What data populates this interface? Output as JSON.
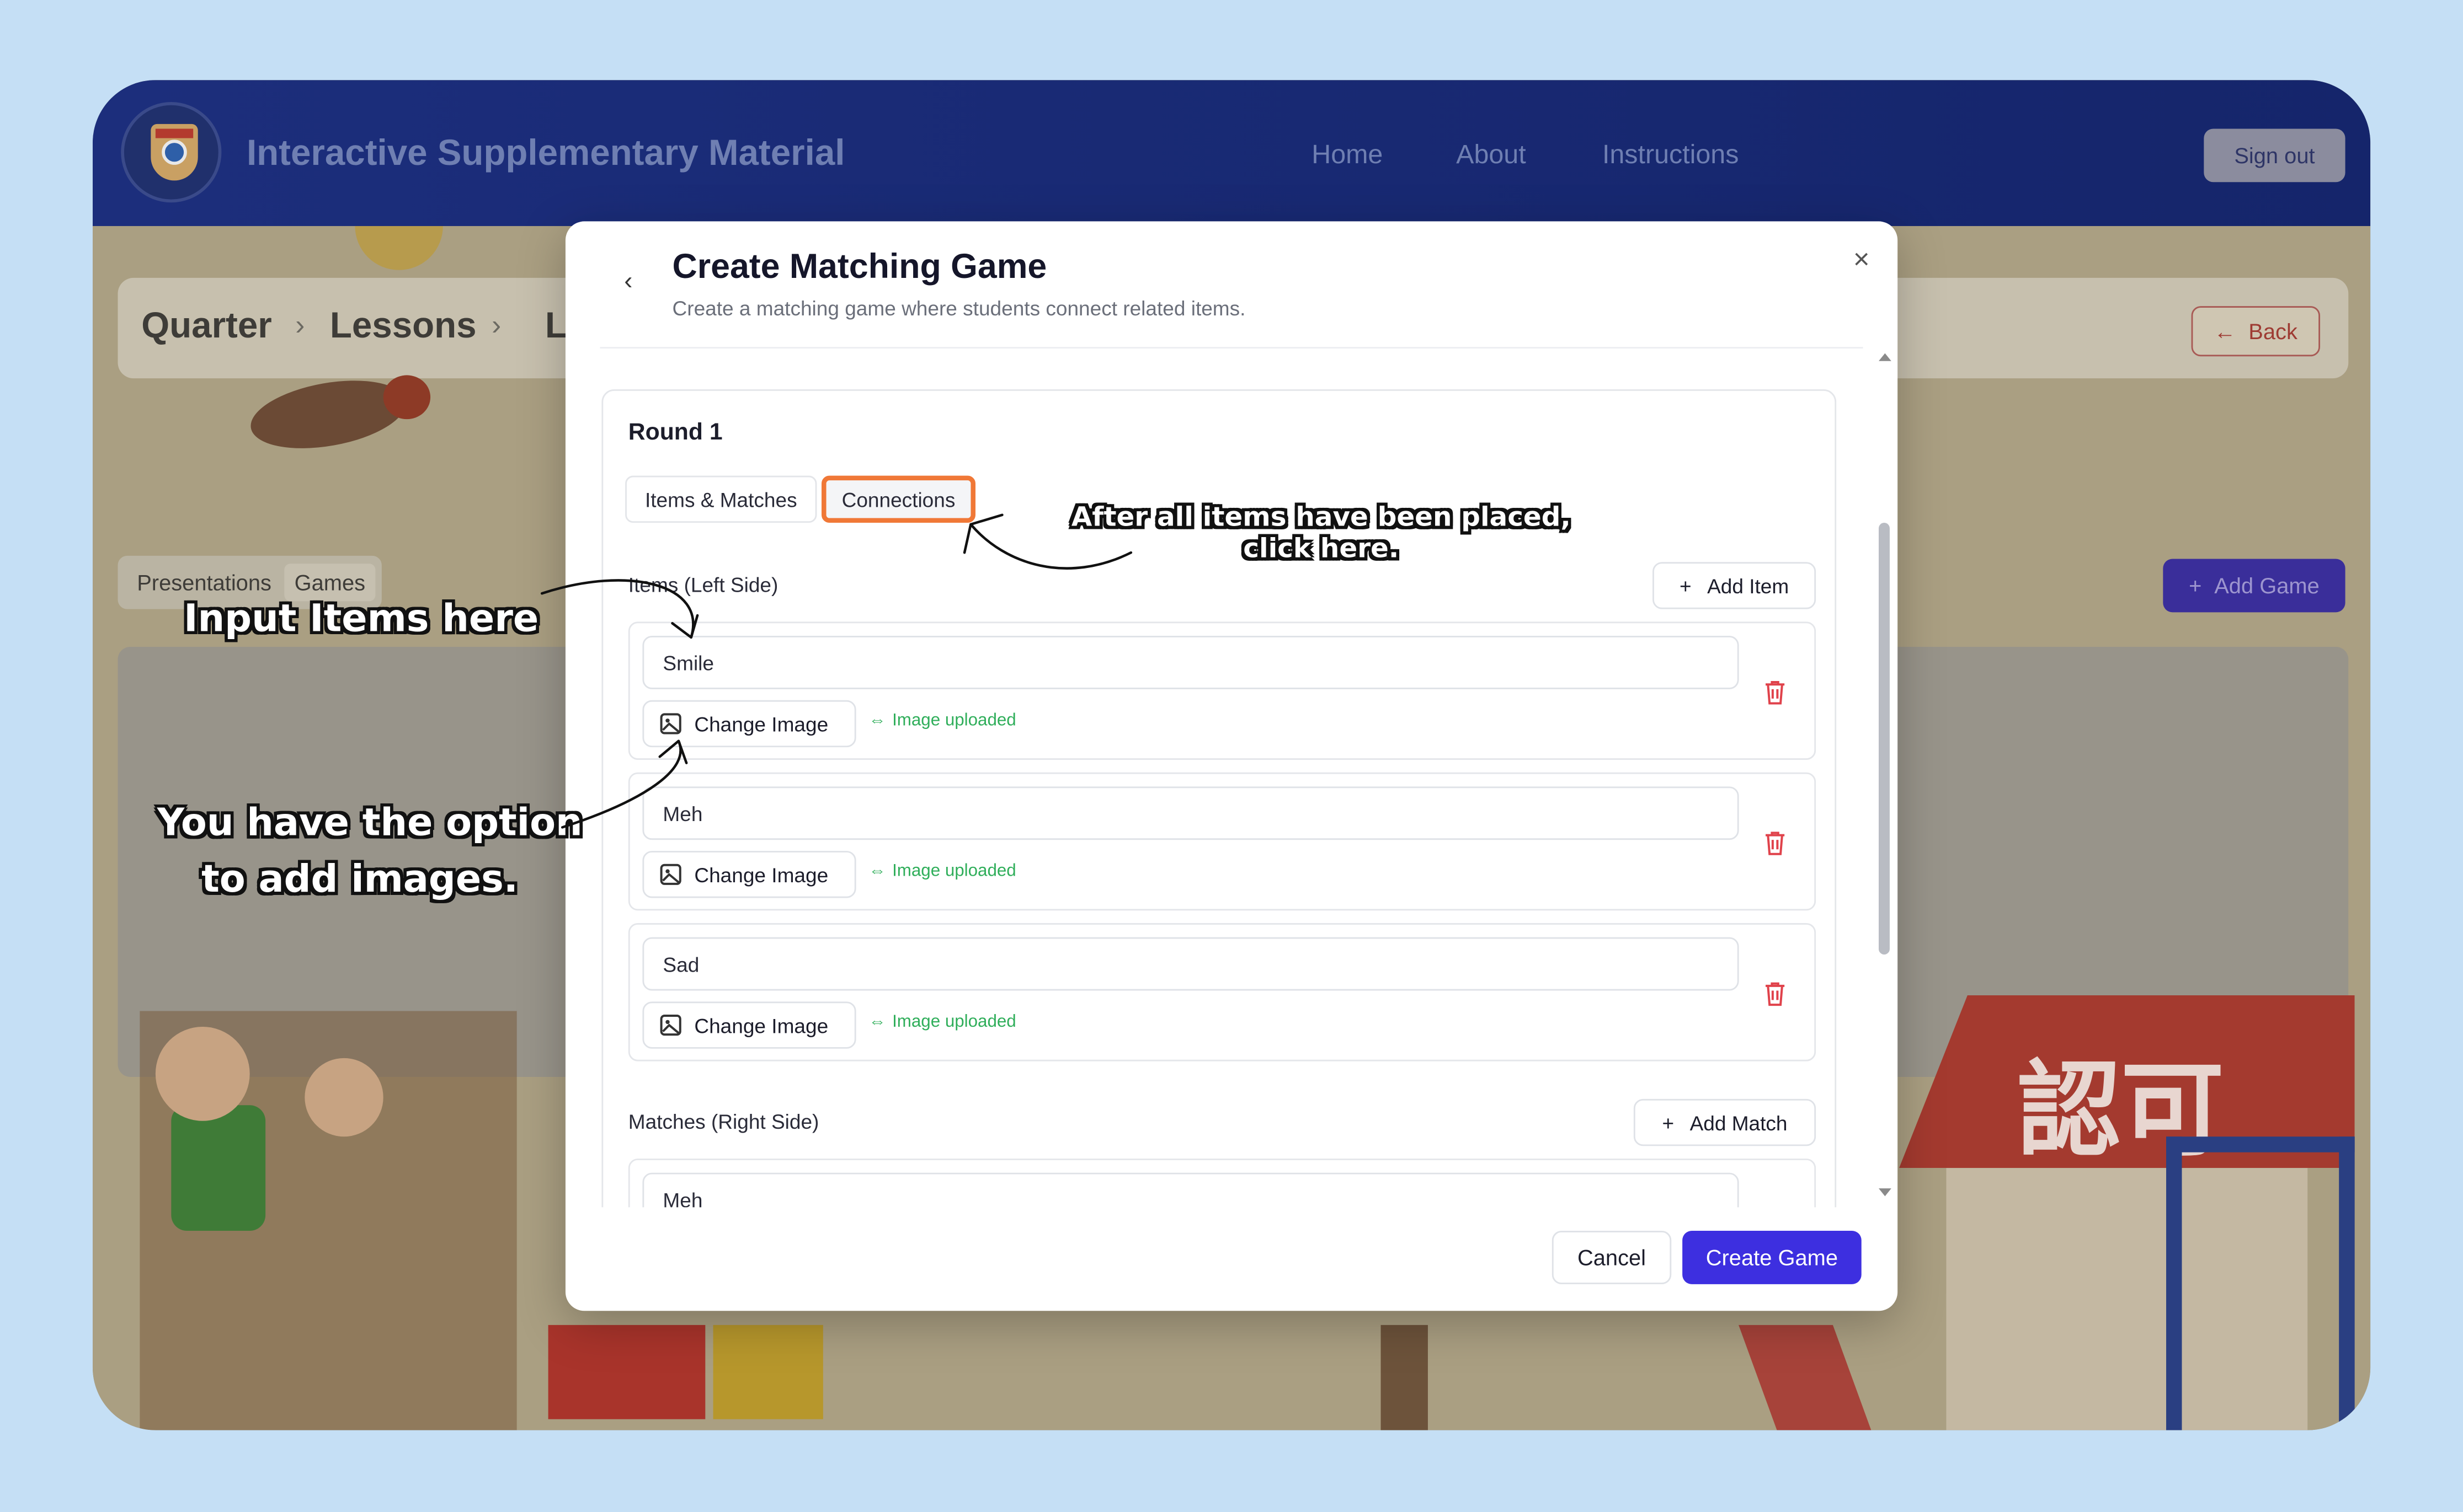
{
  "header": {
    "app_title": "Interactive Supplementary Material",
    "nav": [
      "Home",
      "About",
      "Instructions"
    ],
    "sign_out": "Sign out"
  },
  "background_page": {
    "breadcrumb": [
      "Quarter",
      "Lessons",
      "L"
    ],
    "back_label": "Back",
    "tabs": [
      "Presentations",
      "Games"
    ],
    "add_game_label": "Add Game",
    "roof_sign": "認可"
  },
  "modal": {
    "title": "Create Matching Game",
    "subtitle": "Create a matching game where students connect related items.",
    "round_title": "Round 1",
    "tabs": [
      {
        "label": "Items & Matches",
        "active": false
      },
      {
        "label": "Connections",
        "active": true,
        "highlighted": true
      }
    ],
    "items_label": "Items (Left Side)",
    "add_item_label": "Add Item",
    "items": [
      {
        "value": "Smile",
        "image_button": "Change Image",
        "status": "Image uploaded"
      },
      {
        "value": "Meh",
        "image_button": "Change Image",
        "status": "Image uploaded"
      },
      {
        "value": "Sad",
        "image_button": "Change Image",
        "status": "Image uploaded"
      }
    ],
    "matches_label": "Matches (Right Side)",
    "add_match_label": "Add Match",
    "matches": [
      {
        "value": "Meh"
      }
    ],
    "cancel_label": "Cancel",
    "create_label": "Create Game"
  },
  "annotations": {
    "connections_note_line1": "After all items have been placed,",
    "connections_note_line2": "click here.",
    "items_note": "Input Items here",
    "images_note_line1": "You have the option",
    "images_note_line2": "to add images."
  },
  "colors": {
    "page_bg": "#c5dff5",
    "navbar": "#1c2e7c",
    "primary_button": "#3d2fe0",
    "highlight_outline": "#f07837",
    "uploaded_text": "#2fae5a",
    "delete_icon": "#e0424b"
  }
}
